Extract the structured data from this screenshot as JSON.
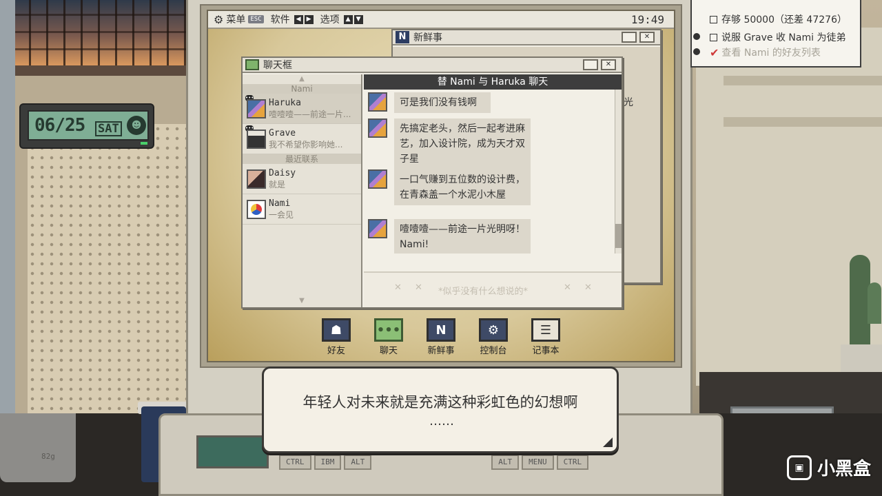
{
  "topbar": {
    "menu_label": "菜单",
    "esc_key": "ESC",
    "software_label": "软件",
    "options_label": "选项",
    "time": "19:49"
  },
  "clock": {
    "date": "06/25",
    "day": "SAT"
  },
  "tasks": [
    {
      "text": "存够 50000（还差 47276）",
      "done": false
    },
    {
      "text": "说服 Grave 收 Nami 为徒弟",
      "done": false
    },
    {
      "text": "查看 Nami 的好友列表",
      "done": true
    }
  ],
  "news_window": {
    "title": "新鲜事",
    "icon_letter": "N",
    "visible_text": "光"
  },
  "chat_window": {
    "title": "聊天框",
    "header": "替 Nami 与 Haruka 聊天",
    "group_nami": "Nami",
    "group_recent": "最近联系",
    "contacts": [
      {
        "name": "Haruka",
        "preview": "噎噎噎——前途一片..."
      },
      {
        "name": "Grave",
        "preview": "我不希望你影响她..."
      },
      {
        "name": "Daisy",
        "preview": "就是"
      },
      {
        "name": "Nami",
        "preview": "一会见"
      }
    ],
    "messages": [
      {
        "text": "可是我们没有钱啊"
      },
      {
        "text": "先搞定老头，然后一起考进麻艺，加入设计院，成为天才双子星"
      },
      {
        "text": "一口气赚到五位数的设计费，在青森盖一个水泥小木屋"
      },
      {
        "text": "噎噎噎——前途一片光明呀！Nami!"
      }
    ],
    "input_placeholder": "*似乎没有什么想说的*"
  },
  "dock": [
    {
      "label": "好友",
      "icon": "friends-icon"
    },
    {
      "label": "聊天",
      "icon": "chat-icon"
    },
    {
      "label": "新鲜事",
      "icon": "news-icon"
    },
    {
      "label": "控制台",
      "icon": "console-icon"
    },
    {
      "label": "记事本",
      "icon": "notepad-icon"
    }
  ],
  "dialog": {
    "text": "年轻人对未来就是充满这种彩虹色的幻想啊",
    "ellipsis": "……"
  },
  "keyboard": {
    "keys": [
      "CTRL",
      "IBM",
      "ALT",
      "ALT",
      "MENU",
      "CTRL"
    ]
  },
  "desk": {
    "mug_label": "82g"
  },
  "watermark": {
    "text": "小黑盒"
  }
}
